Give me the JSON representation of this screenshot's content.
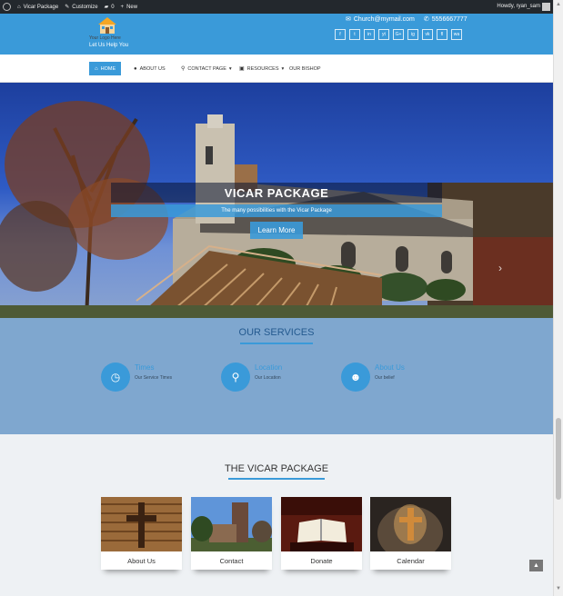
{
  "adminbar": {
    "site_label": "Vicar Package",
    "customize_label": "Customize",
    "comments_count": "0",
    "new_label": "New",
    "howdy": "Howdy, ryan_sam"
  },
  "header": {
    "logo_text": "Your Logo Here",
    "tagline": "Let Us Help You",
    "email": "Church@mymail.com",
    "phone": "5556667777",
    "socials": [
      "f",
      "t",
      "in",
      "yt",
      "G+",
      "ig",
      "vk",
      "fl",
      "wa"
    ]
  },
  "nav": {
    "items": [
      {
        "label": "HOME",
        "icon": "home-icon"
      },
      {
        "label": "ABOUT US",
        "icon": "info-icon"
      },
      {
        "label": "CONTACT PAGE",
        "icon": "location-icon"
      },
      {
        "label": "RESOURCES",
        "icon": "book-icon"
      },
      {
        "label": "OUR BISHOP",
        "icon": ""
      }
    ]
  },
  "hero": {
    "title": "VICAR PACKAGE",
    "subtitle": "The many possibilities with the Vicar Package",
    "button": "Learn More"
  },
  "services": {
    "title": "OUR SERVICES",
    "items": [
      {
        "name": "Times",
        "desc": "Our Service Times",
        "icon": "clock-icon"
      },
      {
        "name": "Location",
        "desc": "Our Location",
        "icon": "map-pin-icon"
      },
      {
        "name": "About Us",
        "desc": "Our belief",
        "icon": "users-icon"
      }
    ]
  },
  "package": {
    "title": "THE VICAR PACKAGE",
    "cards": [
      {
        "label": "About Us"
      },
      {
        "label": "Contact"
      },
      {
        "label": "Donate"
      },
      {
        "label": "Calendar"
      }
    ]
  },
  "colors": {
    "accent": "#3a9ad9",
    "services_bg": "#7fa7cf",
    "adminbar": "#23282d"
  }
}
